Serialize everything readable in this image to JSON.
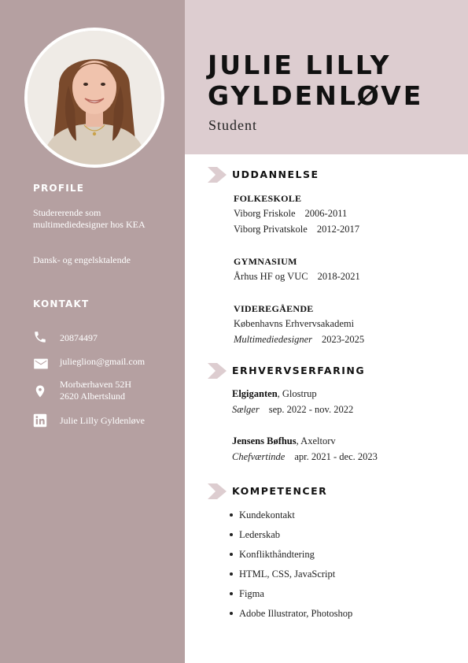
{
  "colors": {
    "sidebar": "#b5a0a1",
    "header": "#ddcdd0",
    "chevron": "#ddcdd0"
  },
  "person": {
    "first_line": "JULIE LILLY",
    "second_line": "GYLDENLØVE",
    "role": "Student"
  },
  "profile": {
    "heading": "PROFILE",
    "text": "Studererende som multimediedesigner hos KEA",
    "languages": "Dansk- og engelsktalende"
  },
  "contact": {
    "heading": "KONTAKT",
    "phone": "20874497",
    "email": "julieglion@gmail.com",
    "address_line1": "Morbærhaven 52H",
    "address_line2": "2620 Albertslund",
    "linkedin": "Julie Lilly Gyldenløve",
    "icons": [
      "phone-icon",
      "email-icon",
      "location-icon",
      "linkedin-icon"
    ]
  },
  "education": {
    "heading": "UDDANNELSE",
    "groups": [
      {
        "label": "FOLKESKOLE",
        "rows": [
          {
            "school": "Viborg Friskole",
            "years": "2006-2011"
          },
          {
            "school": "Viborg Privatskole",
            "years": "2012-2017"
          }
        ]
      },
      {
        "label": "GYMNASIUM",
        "rows": [
          {
            "school": "Århus HF og VUC",
            "years": "2018-2021"
          }
        ]
      },
      {
        "label": "VIDEREGÅENDE",
        "rows": [
          {
            "school": "Københavns Erhvervsakademi",
            "years": ""
          },
          {
            "school": "Multimediedesigner",
            "years": "2023-2025"
          }
        ]
      }
    ]
  },
  "experience": {
    "heading": "ERHVERVSERFARING",
    "jobs": [
      {
        "company": "Elgiganten",
        "location": ", Glostrup",
        "title": "Sælger",
        "period": "sep. 2022 - nov. 2022"
      },
      {
        "company": "Jensens Bøfhus",
        "location": ", Axeltorv",
        "title": "Chefværtinde",
        "period": "apr. 2021 - dec. 2023"
      }
    ]
  },
  "skills": {
    "heading": "KOMPETENCER",
    "items": [
      "Kundekontakt",
      "Lederskab",
      "Konflikthåndtering",
      "HTML, CSS, JavaScript",
      "Figma",
      "Adobe Illustrator, Photoshop"
    ]
  }
}
